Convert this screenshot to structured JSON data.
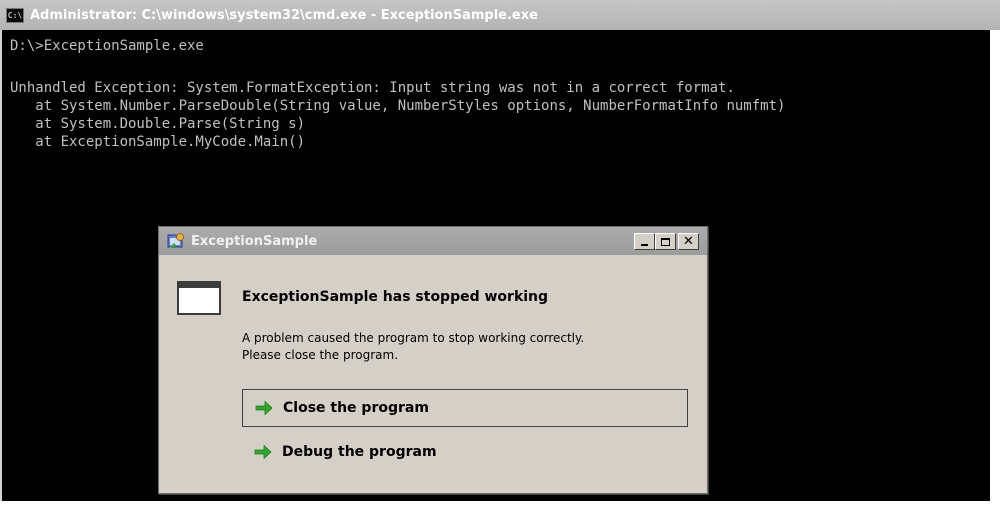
{
  "cmd_window": {
    "title": "Administrator: C:\\windows\\system32\\cmd.exe - ExceptionSample.exe",
    "icon_text": "C:\\",
    "lines": [
      "D:\\>ExceptionSample.exe",
      "",
      "Unhandled Exception: System.FormatException: Input string was not in a correct format.",
      "   at System.Number.ParseDouble(String value, NumberStyles options, NumberFormatInfo numfmt)",
      "   at System.Double.Parse(String s)",
      "   at ExceptionSample.MyCode.Main()"
    ]
  },
  "dialog": {
    "title": "ExceptionSample",
    "heading": "ExceptionSample has stopped working",
    "description_line1": "A problem caused the program to stop working correctly.",
    "description_line2": "Please close the program.",
    "options": {
      "close": "Close the program",
      "debug": "Debug the program"
    },
    "icons": {
      "app": "app-icon",
      "program": "program-window-icon",
      "option_arrow": "green-arrow-icon"
    },
    "colors": {
      "arrow": "#2ea82a"
    }
  }
}
